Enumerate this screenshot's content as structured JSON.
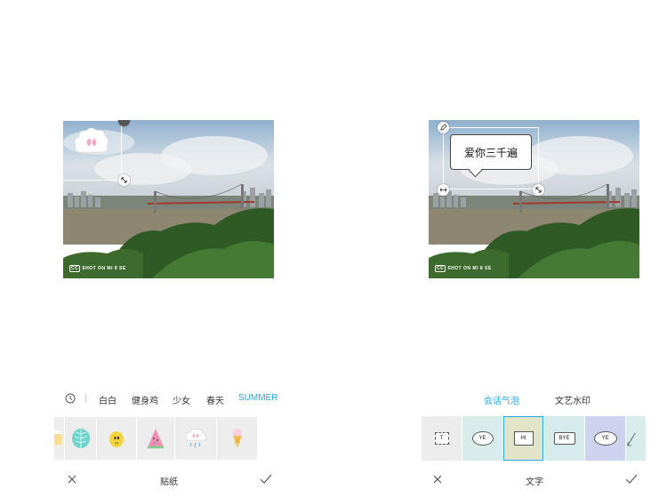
{
  "left": {
    "photo": {
      "watermark_badge": "CC",
      "watermark_text": "SHOT ON MI 8 SE"
    },
    "categories": {
      "recent_icon": "clock-icon",
      "items": [
        {
          "label": "白白",
          "active": false
        },
        {
          "label": "健身鸡",
          "active": false
        },
        {
          "label": "少女",
          "active": false
        },
        {
          "label": "春天",
          "active": false
        },
        {
          "label": "SUMMER",
          "active": true
        }
      ]
    },
    "stickers": [
      "half-sticker",
      "leaf-sticker",
      "chick-sticker",
      "watermelon-sticker",
      "rain-cloud-sticker",
      "ice-cream-sticker"
    ],
    "bottom": {
      "cancel_icon": "close-icon",
      "title": "贴纸",
      "confirm_icon": "check-icon"
    }
  },
  "right": {
    "photo": {
      "watermark_badge": "CC",
      "watermark_text": "SHOT ON MI 8 SE"
    },
    "speech_bubble_text": "爱你三千遍",
    "tabs": [
      {
        "label": "会话气泡",
        "active": true
      },
      {
        "label": "文艺水印",
        "active": false
      }
    ],
    "bubbles": [
      {
        "label": "T",
        "style": "text-box"
      },
      {
        "label": "YE",
        "style": "round"
      },
      {
        "label": "HI",
        "style": "square",
        "selected": true
      },
      {
        "label": "BYE",
        "style": "rect"
      },
      {
        "label": "YE",
        "style": "oval"
      },
      {
        "label": "",
        "style": "partial"
      }
    ],
    "bottom": {
      "cancel_icon": "close-icon",
      "title": "文字",
      "confirm_icon": "check-icon"
    }
  },
  "colors": {
    "accent": "#2aa6e0",
    "tile_bg": "#ededed"
  }
}
